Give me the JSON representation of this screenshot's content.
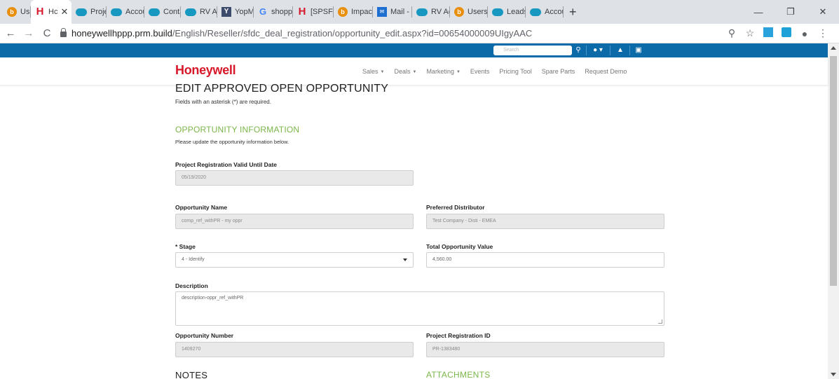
{
  "browser": {
    "tabs": [
      {
        "label": "Users",
        "icon": "orange-b-icon"
      },
      {
        "label": "Hc",
        "icon": "honeywell-h-icon",
        "active": true
      },
      {
        "label": "Projec",
        "icon": "salesforce-cloud-icon"
      },
      {
        "label": "Accou",
        "icon": "salesforce-cloud-icon"
      },
      {
        "label": "Conta",
        "icon": "salesforce-cloud-icon"
      },
      {
        "label": "RV Ac",
        "icon": "salesforce-cloud-icon"
      },
      {
        "label": "YopM",
        "icon": "yopmail-icon"
      },
      {
        "label": "shopp",
        "icon": "google-g-icon"
      },
      {
        "label": "[SPSF",
        "icon": "honeywell-h-icon"
      },
      {
        "label": "Impac",
        "icon": "orange-b-icon"
      },
      {
        "label": "Mail -",
        "icon": "outlook-mail-icon"
      },
      {
        "label": "RV Ac",
        "icon": "salesforce-cloud-icon"
      },
      {
        "label": "Users",
        "icon": "orange-b-icon"
      },
      {
        "label": "Leads",
        "icon": "salesforce-cloud-icon"
      },
      {
        "label": "Accou",
        "icon": "salesforce-cloud-icon"
      }
    ],
    "url_host": "honeywellhppp.prm.build",
    "url_path": "/English/Reseller/sfdc_deal_registration/opportunity_edit.aspx?id=00654000009UIgyAAC"
  },
  "site": {
    "search_placeholder": "Search",
    "logo": "Honeywell",
    "menu": [
      {
        "label": "Sales",
        "dropdown": true
      },
      {
        "label": "Deals",
        "dropdown": true
      },
      {
        "label": "Marketing",
        "dropdown": true
      },
      {
        "label": "Events",
        "dropdown": false
      },
      {
        "label": "Pricing Tool",
        "dropdown": false
      },
      {
        "label": "Spare Parts",
        "dropdown": false
      },
      {
        "label": "Request Demo",
        "dropdown": false
      }
    ]
  },
  "form": {
    "page_title": "EDIT APPROVED OPEN OPPORTUNITY",
    "required_note": "Fields with an asterisk (*) are required.",
    "section_title": "OPPORTUNITY INFORMATION",
    "section_subtitle": "Please update the opportunity information below.",
    "valid_until_label": "Project Registration Valid Until Date",
    "valid_until_value": "05/19/2020",
    "opportunity_name_label": "Opportunity Name",
    "opportunity_name_value": "comp_ref_withPR - my oppr",
    "preferred_distributor_label": "Preferred Distributor",
    "preferred_distributor_value": "Test Company - Disti - EMEA",
    "stage_label": "* Stage",
    "stage_value": "4 - Identify",
    "total_value_label": "Total Opportunity Value",
    "total_value_value": "4,560.00",
    "description_label": "Description",
    "description_value": "description-oppr_ref_withPR",
    "opportunity_number_label": "Opportunity Number",
    "opportunity_number_value": "1409270",
    "project_reg_id_label": "Project Registration ID",
    "project_reg_id_value": "PR-1383480",
    "notes_heading": "NOTES",
    "attachments_heading": "ATTACHMENTS"
  },
  "colors": {
    "brand_red": "#d7182a",
    "site_blue": "#0d6aa8",
    "section_green": "#7ab648"
  }
}
